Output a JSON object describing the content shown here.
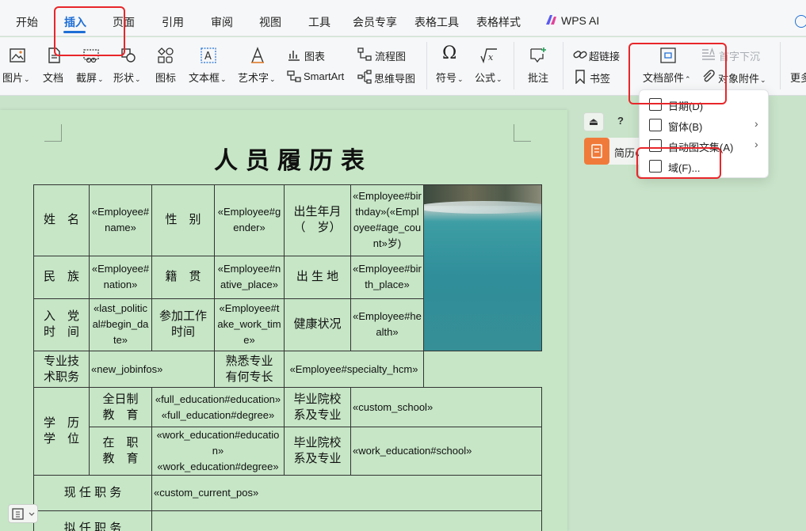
{
  "tabs": [
    "开始",
    "插入",
    "页面",
    "引用",
    "审阅",
    "视图",
    "工具",
    "会员专享",
    "表格工具",
    "表格样式",
    "WPS AI"
  ],
  "active_tab": "插入",
  "ribbon": {
    "picture": "图片",
    "document": "文档",
    "screenshot": "截屏",
    "shape": "形状",
    "icon": "图标",
    "textbox": "文本框",
    "wordart": "艺术字",
    "chart": "图表",
    "smartart": "SmartArt",
    "flowchart": "流程图",
    "mindmap": "思维导图",
    "symbol": "符号",
    "formula": "公式",
    "comment": "批注",
    "hyperlink": "超链接",
    "bookmark": "书签",
    "doc_parts": "文档部件",
    "drop_cap": "首字下沉",
    "attachment": "对象附件",
    "more": "更多"
  },
  "menu": {
    "items": [
      {
        "label": "日期(D)",
        "icon": "calendar-icon",
        "submenu": false
      },
      {
        "label": "窗体(B)",
        "icon": "form-icon",
        "submenu": true
      },
      {
        "label": "自动图文集(A)",
        "icon": "autotext-icon",
        "submenu": true
      },
      {
        "label": "域(F)...",
        "icon": "field-icon",
        "submenu": false
      }
    ]
  },
  "right_panel": {
    "help": "?",
    "card_label": "简历の"
  },
  "document": {
    "title": "人员履历表",
    "labels": {
      "name": "姓　名",
      "gender": "性　别",
      "birth": "出生年月\n（　岁）",
      "ethnic": "民　族",
      "native": "籍　贯",
      "birthplace": "出 生 地",
      "party": "入　党\n时　间",
      "work_time": "参加工作\n时间",
      "health": "健康状况",
      "title_post": "专业技\n术职务",
      "specialty": "熟悉专业\n有何专长",
      "education": "学　历\n学　位",
      "fulltime": "全日制\n教　育",
      "school1": "毕业院校\n系及专业",
      "onjob": "在　职\n教　育",
      "school2": "毕业院校\n系及专业",
      "current_pos": "现 任 职 务",
      "proposed_pos": "拟 任 职 务"
    },
    "fields": {
      "name": "«Employee#name»",
      "gender": "«Employee#gender»",
      "birthday": "«Employee#birthday»(«Employee#age_count»岁)",
      "nation": "«Employee#nation»",
      "native_place": "«Employee#native_place»",
      "birth_place": "«Employee#birth_place»",
      "party_date": "«last_political#begin_date»",
      "take_work_time": "«Employee#take_work_time»",
      "health": "«Employee#health»",
      "new_jobinfos": "«new_jobinfos»",
      "specialty": "«Employee#specialty_hcm»",
      "full_edu": "«full_education#education»\n«full_education#degree»",
      "custom_school": "«custom_school»",
      "work_edu": "«work_education#education»\n«work_education#degree»",
      "work_school": "«work_education#school»",
      "current_pos": "«custom_current_pos»",
      "proposed_pos": ""
    }
  },
  "colors": {
    "accent": "#1f6fd6",
    "highlight": "#e8262a",
    "page": "#c6e6c6"
  }
}
